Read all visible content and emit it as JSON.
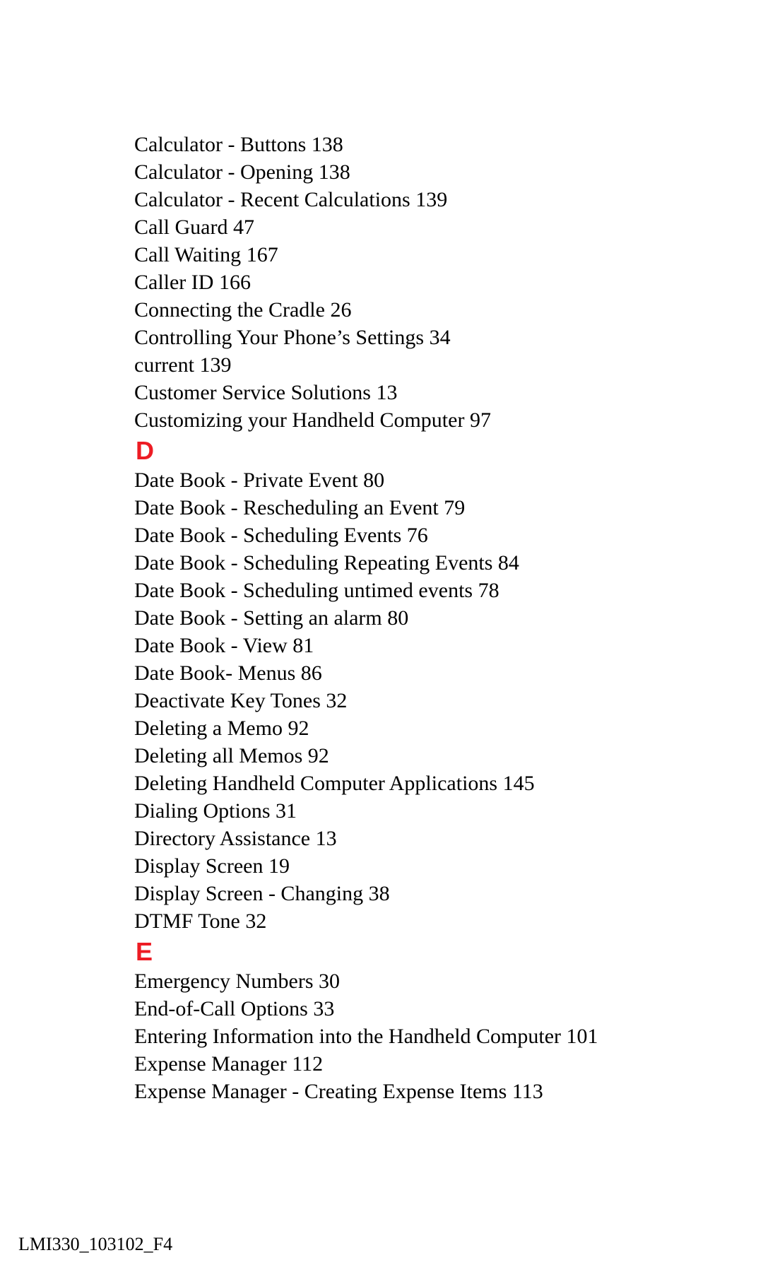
{
  "sections": [
    {
      "header": null,
      "entries": [
        {
          "text": "Calculator - Buttons",
          "page": "138"
        },
        {
          "text": "Calculator - Opening",
          "page": "138"
        },
        {
          "text": "Calculator - Recent Calculations",
          "page": "139"
        },
        {
          "text": "Call Guard",
          "page": "47"
        },
        {
          "text": "Call Waiting",
          "page": "167"
        },
        {
          "text": "Caller ID",
          "page": "166"
        },
        {
          "text": "Connecting the Cradle",
          "page": "26"
        },
        {
          "text": "Controlling Your Phone’s Settings",
          "page": "34"
        },
        {
          "text": "current",
          "page": "139"
        },
        {
          "text": "Customer Service Solutions",
          "page": "13"
        },
        {
          "text": "Customizing your Handheld Computer",
          "page": "97"
        }
      ]
    },
    {
      "header": "D",
      "entries": [
        {
          "text": "Date Book - Private Event",
          "page": "80"
        },
        {
          "text": "Date Book - Rescheduling an Event",
          "page": "79"
        },
        {
          "text": "Date Book - Scheduling Events",
          "page": "76"
        },
        {
          "text": "Date Book - Scheduling Repeating Events",
          "page": "84"
        },
        {
          "text": "Date Book - Scheduling untimed events",
          "page": "78"
        },
        {
          "text": "Date Book - Setting an alarm",
          "page": "80"
        },
        {
          "text": "Date Book - View",
          "page": "81"
        },
        {
          "text": "Date Book- Menus",
          "page": "86"
        },
        {
          "text": "Deactivate Key Tones",
          "page": "32"
        },
        {
          "text": "Deleting a Memo",
          "page": "92"
        },
        {
          "text": "Deleting all Memos",
          "page": "92"
        },
        {
          "text": "Deleting Handheld Computer Applications",
          "page": "145"
        },
        {
          "text": "Dialing Options",
          "page": "31"
        },
        {
          "text": "Directory Assistance",
          "page": "13"
        },
        {
          "text": "Display Screen",
          "page": "19"
        },
        {
          "text": "Display Screen - Changing",
          "page": "38"
        },
        {
          "text": "DTMF Tone",
          "page": "32"
        }
      ]
    },
    {
      "header": "E",
      "entries": [
        {
          "text": "Emergency Numbers",
          "page": "30"
        },
        {
          "text": "End-of-Call Options",
          "page": "33"
        },
        {
          "text": "Entering Information into the Handheld Computer",
          "page": "101"
        },
        {
          "text": "Expense Manager",
          "page": "112"
        },
        {
          "text": "Expense Manager - Creating Expense Items",
          "page": "113"
        }
      ]
    }
  ],
  "footer": "LMI330_103102_F4"
}
